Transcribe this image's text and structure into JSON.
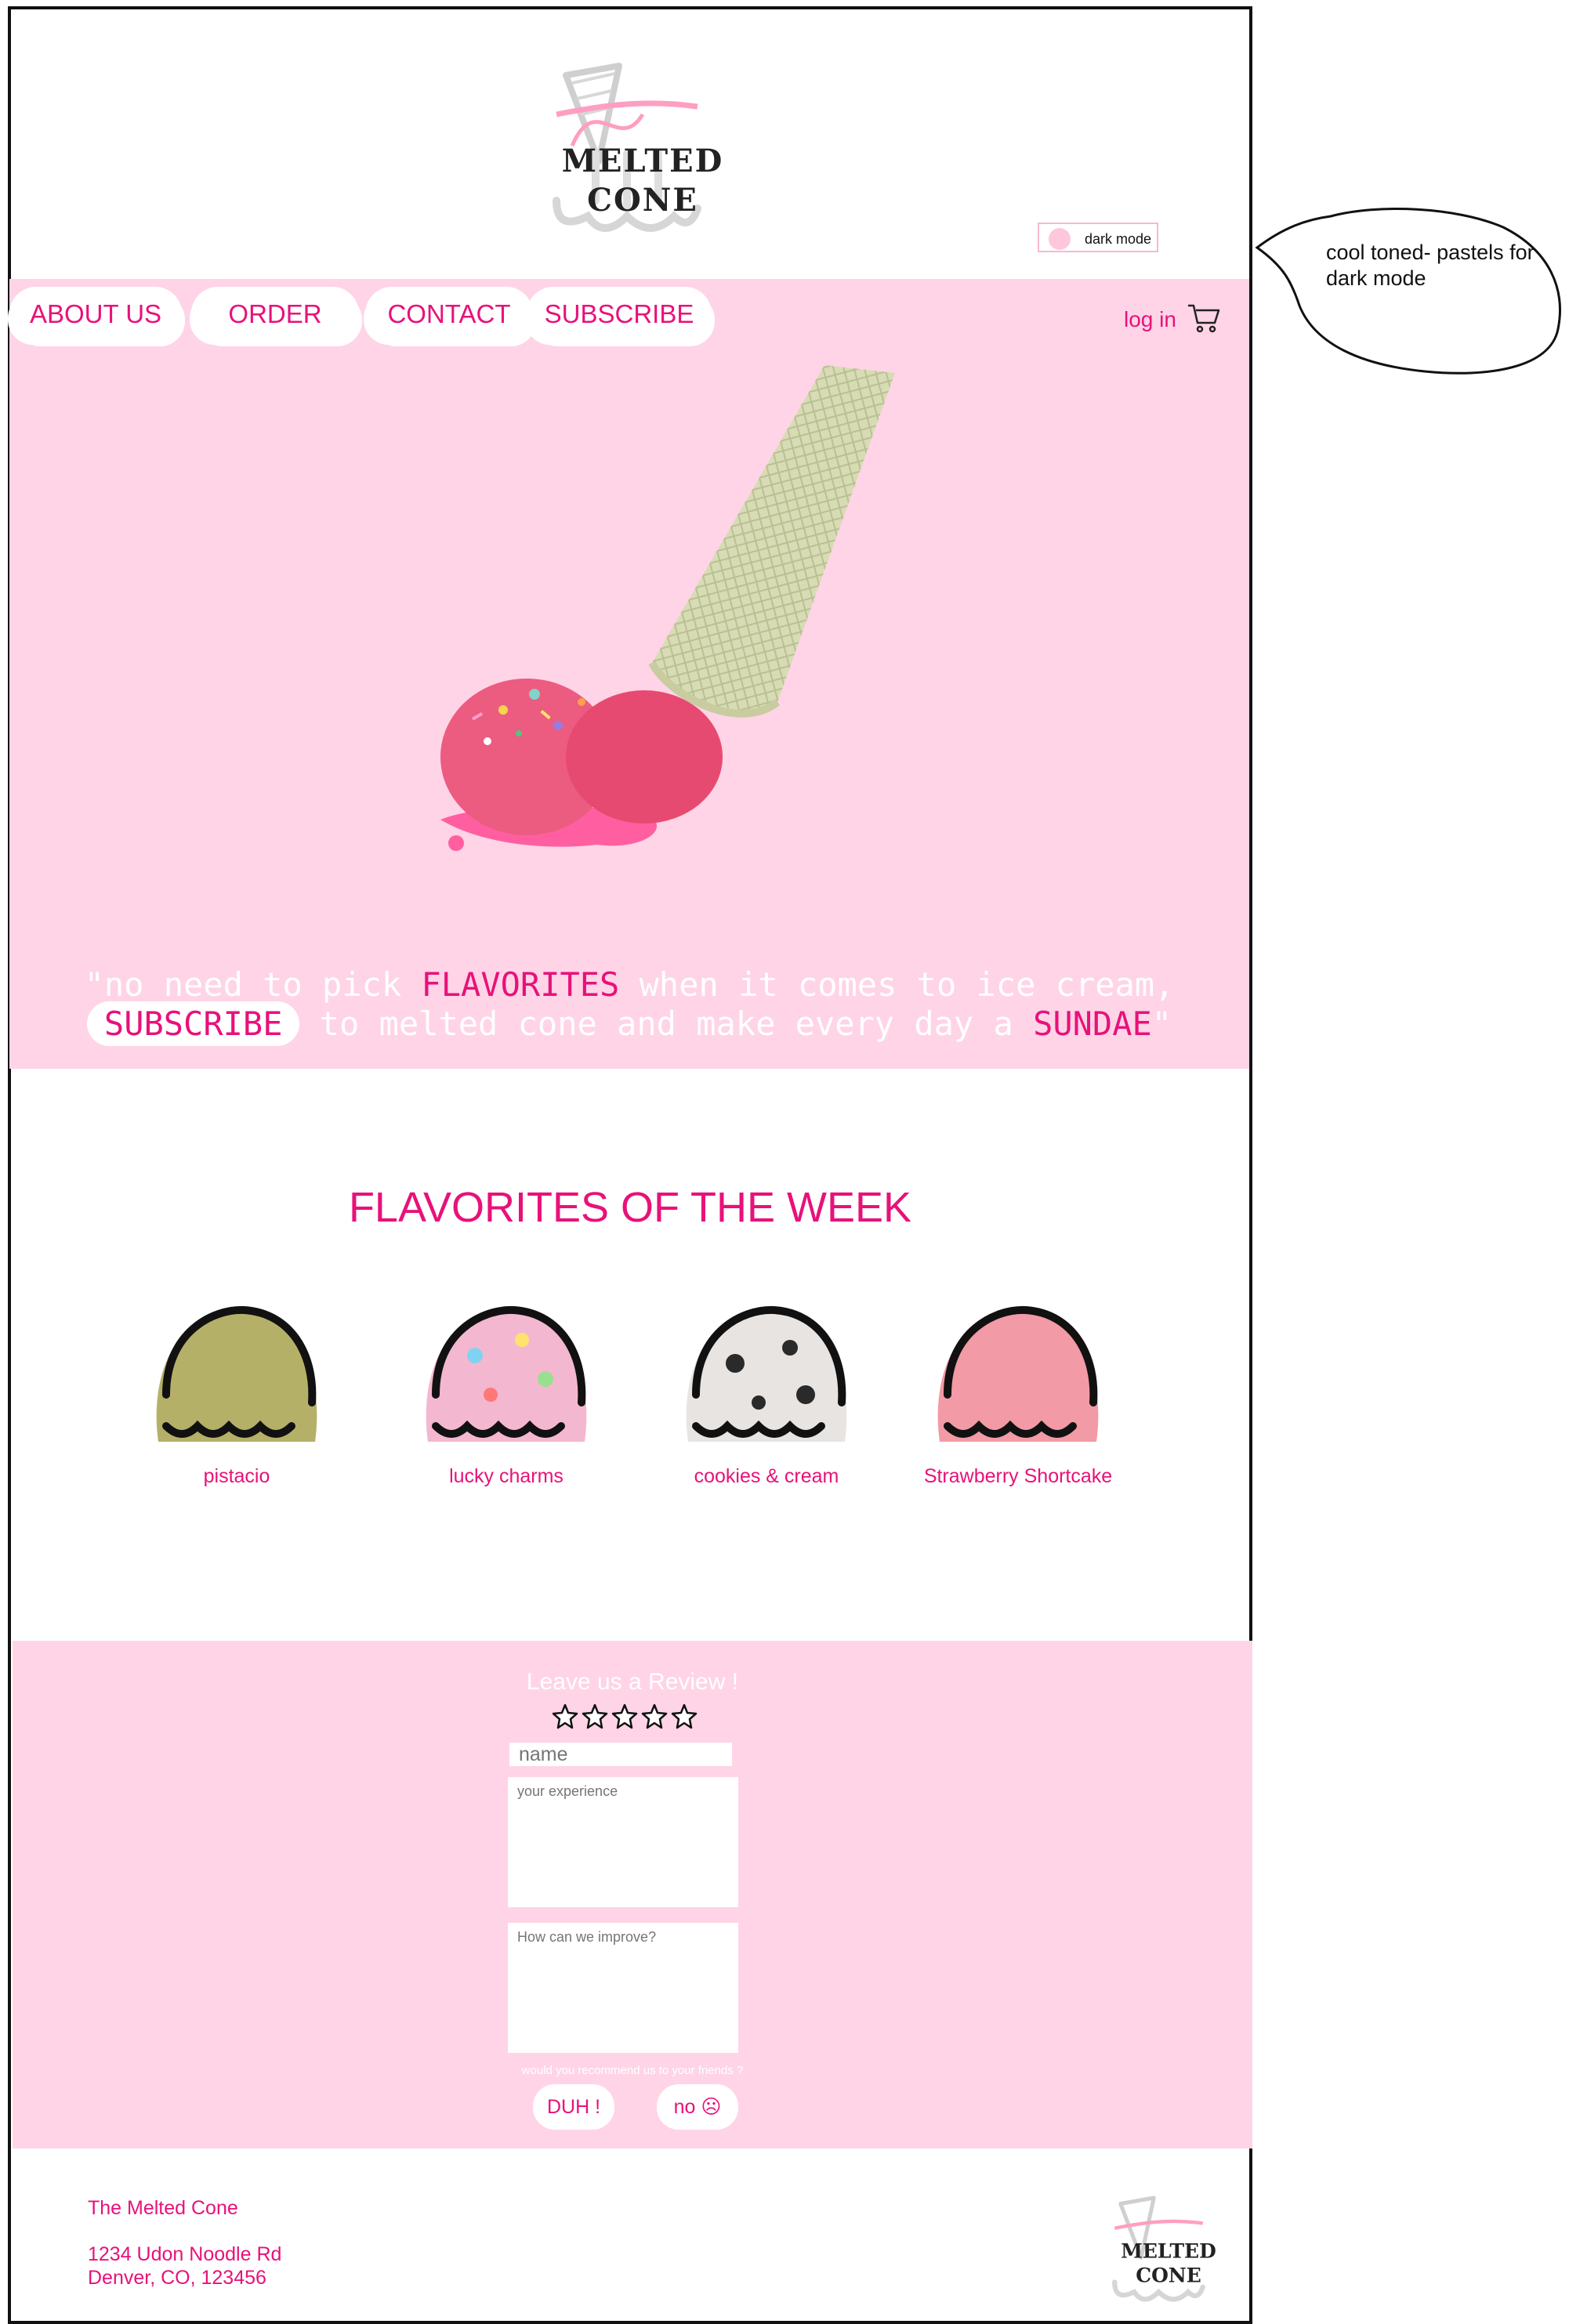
{
  "brand": {
    "line1": "MELTED",
    "line2": "CONE"
  },
  "header": {
    "dark_mode_label": "dark mode"
  },
  "annotation": {
    "note": "cool toned- pastels for dark mode"
  },
  "nav": {
    "items": [
      {
        "label": "ABOUT US"
      },
      {
        "label": "ORDER"
      },
      {
        "label": "CONTACT"
      },
      {
        "label": "SUBSCRIBE"
      }
    ],
    "login_label": "log in"
  },
  "hero": {
    "quote": {
      "p1": "\"no need to pick ",
      "flavorites": "FLAVORITES",
      "p2": " when it comes to ice cream,",
      "subscribe": "SUBSCRIBE",
      "p3": " to melted cone and make every day a ",
      "sundae": "SUNDAE",
      "p4": "\""
    }
  },
  "flavors": {
    "title": "FLAVORITES OF THE WEEK",
    "items": [
      {
        "name": "pistacio",
        "color": "#b5b068"
      },
      {
        "name": "lucky charms",
        "color": "#f4b7d0"
      },
      {
        "name": "cookies & cream",
        "color": "#e8e4e2"
      },
      {
        "name": "Strawberry Shortcake",
        "color": "#f29aa5"
      }
    ]
  },
  "review": {
    "title": "Leave us a Review !",
    "name_placeholder": "name",
    "experience_placeholder": "your experience",
    "improve_placeholder": "How can we improve?",
    "recommend_question": "would you recommend us to your friends ?",
    "yes_label": "DUH !",
    "no_label": "no ☹"
  },
  "footer": {
    "name": "The Melted Cone",
    "address_line1": "1234 Udon Noodle Rd",
    "address_line2": "Denver, CO, 123456"
  },
  "colors": {
    "accent": "#e8117a",
    "hero_bg": "#ffd4e6",
    "white": "#ffffff"
  }
}
